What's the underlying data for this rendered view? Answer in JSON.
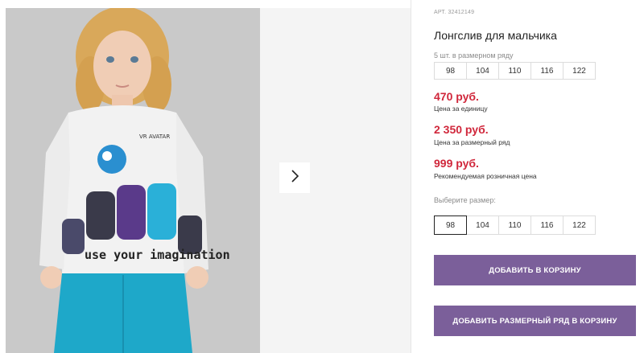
{
  "product": {
    "art_label": "АРТ.",
    "art_number": "32412149",
    "title": "Лонгслив для мальчика",
    "pack_note": "5 шт. в размерном ряду",
    "pack_sizes": [
      "98",
      "104",
      "110",
      "116",
      "122"
    ],
    "prices": [
      {
        "value": "470 руб.",
        "label": "Цена за единицу"
      },
      {
        "value": "2 350 руб.",
        "label": "Цена за размерный ряд"
      },
      {
        "value": "999 руб.",
        "label": "Рекомендуемая розничная цена"
      }
    ],
    "choose_size_label": "Выберите размер:",
    "size_options": [
      "98",
      "104",
      "110",
      "116",
      "122"
    ],
    "selected_size": "98"
  },
  "buttons": {
    "add_to_cart": "ДОБАВИТЬ В КОРЗИНУ",
    "add_pack_to_cart": "ДОБАВИТЬ РАЗМЕРНЫЙ РЯД В КОРЗИНУ"
  },
  "gallery": {
    "next_icon": "chevron-right-icon",
    "shirt_text_brand": "VR AVATAR",
    "shirt_text_slogan": "use your imagination"
  },
  "colors": {
    "price": "#d0273b",
    "button": "#7b5f9a",
    "photo_bg": "#c9c9c9",
    "shorts": "#1ea8c9"
  }
}
